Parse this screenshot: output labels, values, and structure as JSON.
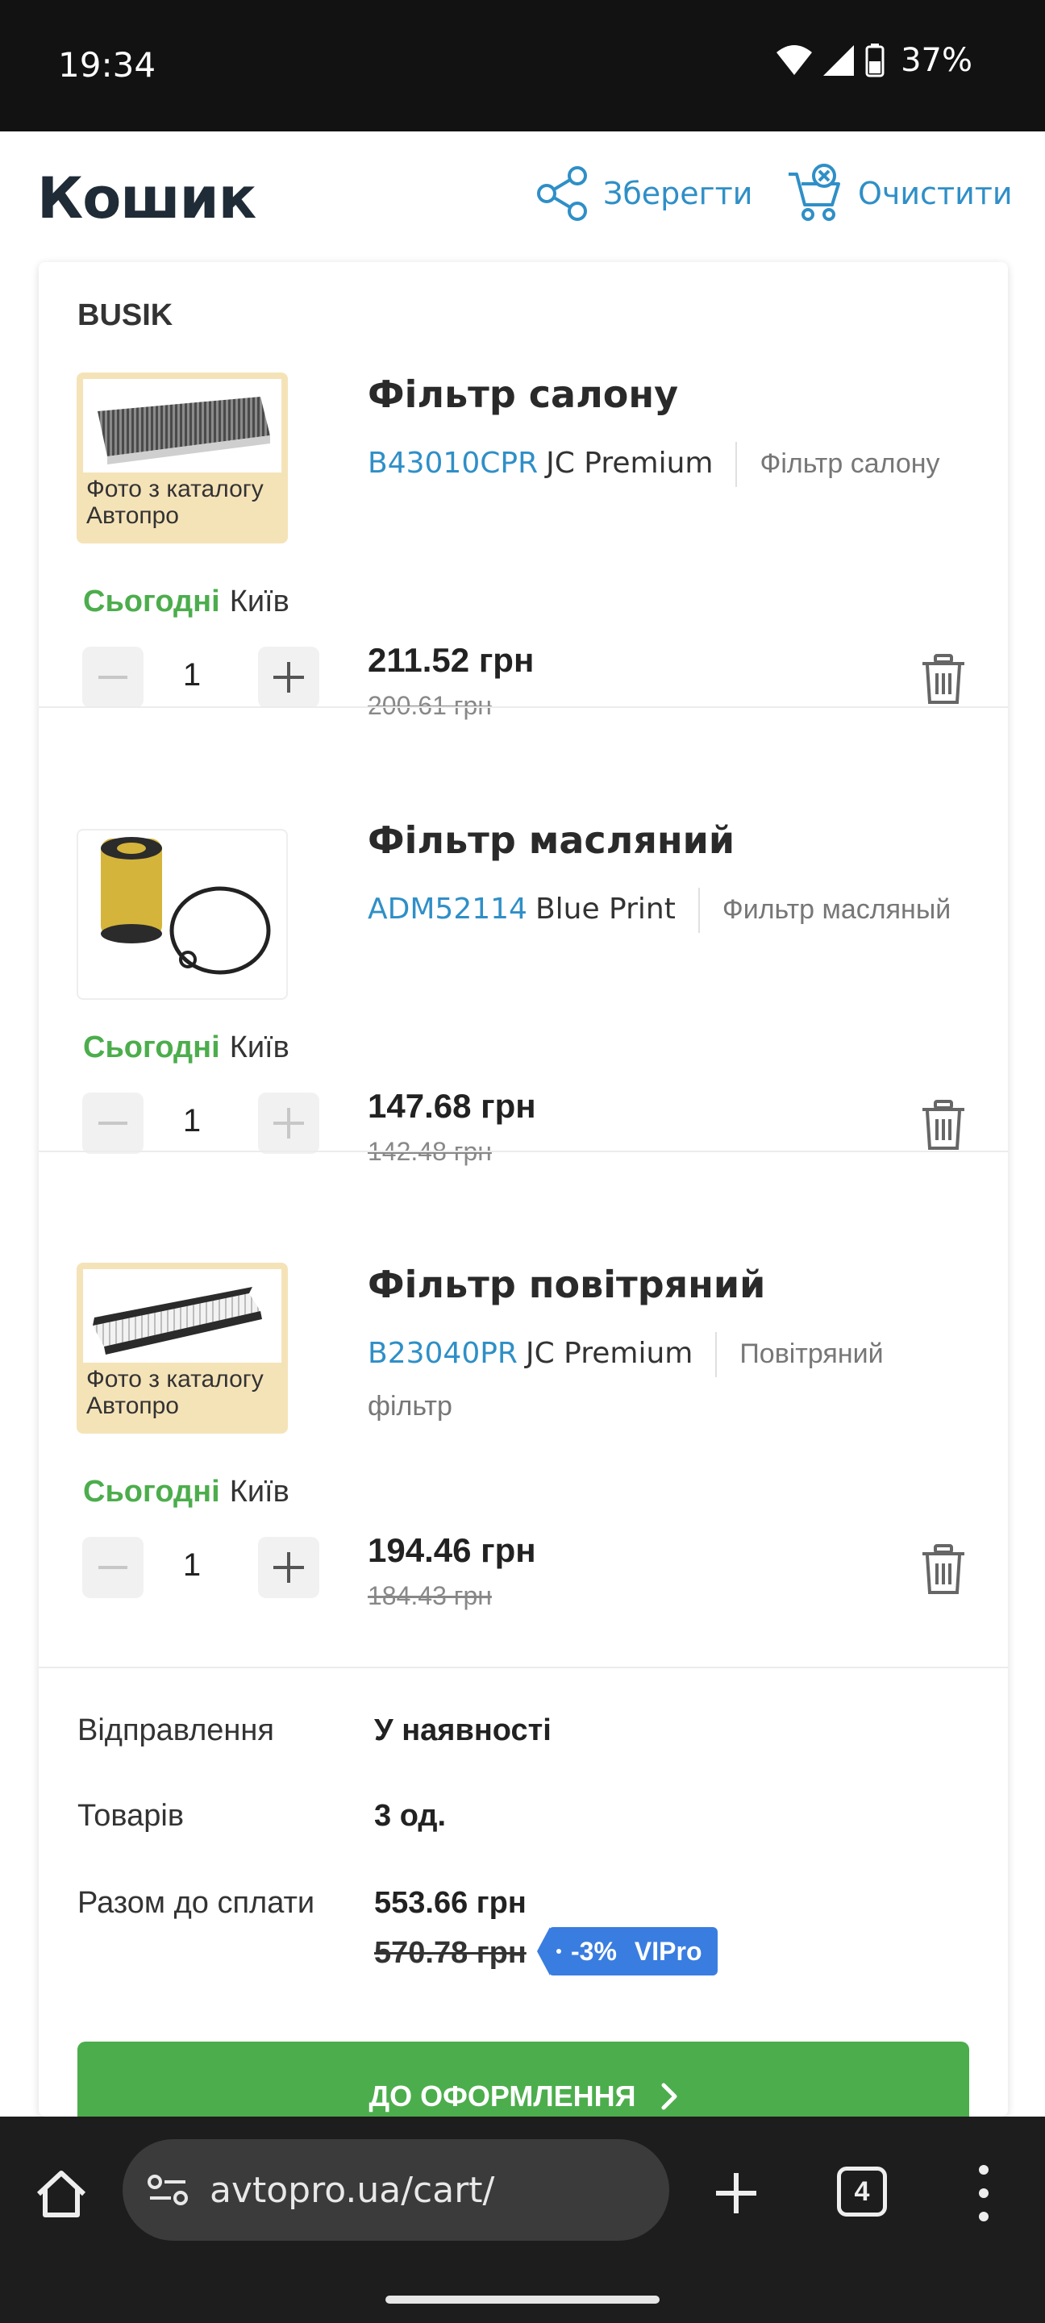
{
  "status_bar": {
    "time": "19:34",
    "battery": "37%"
  },
  "header": {
    "title": "Кошик",
    "save_label": "Зберегти",
    "clear_label": "Очистити"
  },
  "cart": {
    "seller": "BUSIK",
    "items": [
      {
        "name": "Фільтр салону",
        "code": "B43010CPR",
        "brand": "JC Premium",
        "desc": "Фільтр салону",
        "photo_caption": "Фото з каталогу Автопро",
        "availability": "Сьогодні",
        "city": "Київ",
        "qty": "1",
        "price": "211.52 грн",
        "old_price": "200.61 грн"
      },
      {
        "name": "Фільтр масляний",
        "code": "ADM52114",
        "brand": "Blue Print",
        "desc": "Фильтр масляный",
        "photo_caption": "",
        "availability": "Сьогодні",
        "city": "Київ",
        "qty": "1",
        "price": "147.68 грн",
        "old_price": "142.48 грн"
      },
      {
        "name": "Фільтр повітряний",
        "code": "B23040PR",
        "brand": "JC Premium",
        "desc": "Повітряний фільтр",
        "photo_caption": "Фото з каталогу Автопро",
        "availability": "Сьогодні",
        "city": "Київ",
        "qty": "1",
        "price": "194.46 грн",
        "old_price": "184.43 грн"
      }
    ]
  },
  "summary": {
    "shipping_label": "Відправлення",
    "shipping_value": "У наявності",
    "items_label": "Товарів",
    "items_value": "3 од.",
    "total_label": "Разом до сплати",
    "total_value": "553.66 грн",
    "old_total": "570.78 грн",
    "discount": "-3%",
    "program": "VIPro",
    "checkout_label": "ДО ОФОРМЛЕННЯ"
  },
  "browser": {
    "url": "avtopro.ua/cart/",
    "tab_count": "4"
  },
  "colors": {
    "accent_blue": "#2f8fc7",
    "green": "#4cad4c",
    "badge_blue": "#3a7de0"
  }
}
